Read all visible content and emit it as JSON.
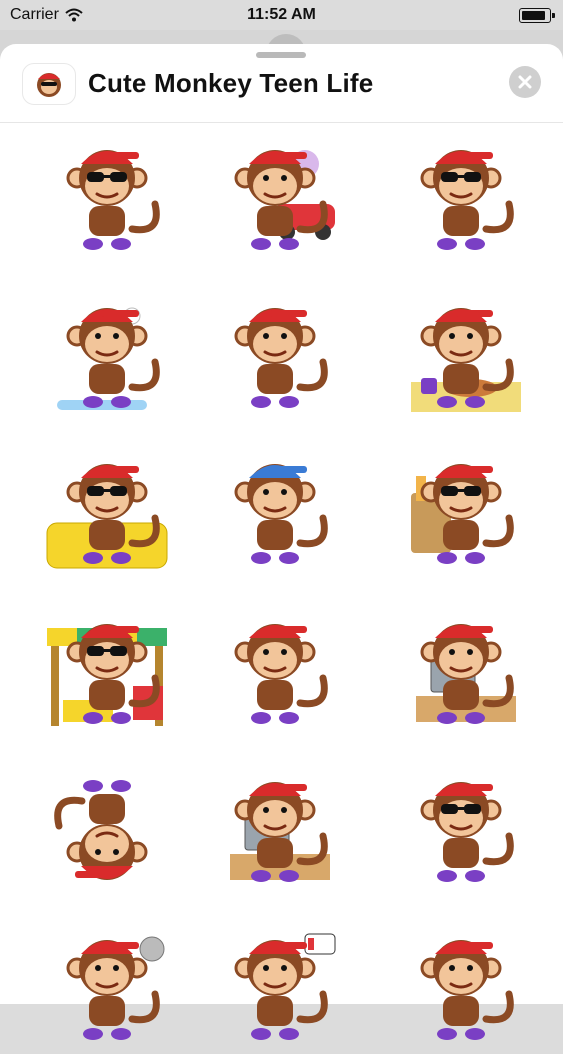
{
  "status_bar": {
    "carrier": "Carrier",
    "time": "11:52 AM",
    "battery_level": 0.9
  },
  "header": {
    "title": "Cute Monkey Teen Life"
  },
  "icons": {
    "app": "monkey-app-icon",
    "close": "close-icon",
    "wifi": "wifi-icon",
    "battery": "battery-icon"
  },
  "colors": {
    "fur": "#8b4a24",
    "face": "#f2c59a",
    "cap": "#d92b2b",
    "shoes": "#7a3fc4",
    "glasses": "#111111"
  },
  "stickers": [
    {
      "name": "monkey-grinning-sunglasses"
    },
    {
      "name": "monkey-hitting-red-car"
    },
    {
      "name": "monkey-pointing-sunglasses"
    },
    {
      "name": "monkey-showering"
    },
    {
      "name": "monkey-angry-phone"
    },
    {
      "name": "monkey-eating-meal"
    },
    {
      "name": "monkey-relaxing-couch"
    },
    {
      "name": "monkey-shocked-wallet"
    },
    {
      "name": "monkey-grocery-bag"
    },
    {
      "name": "monkey-sale-stand"
    },
    {
      "name": "monkey-yawning"
    },
    {
      "name": "monkey-frustrated-computer"
    },
    {
      "name": "monkey-breakdancing"
    },
    {
      "name": "monkey-office-desk"
    },
    {
      "name": "monkey-cool-sunglasses"
    },
    {
      "name": "monkey-music-cd"
    },
    {
      "name": "monkey-low-battery"
    },
    {
      "name": "monkey-sweating"
    }
  ]
}
